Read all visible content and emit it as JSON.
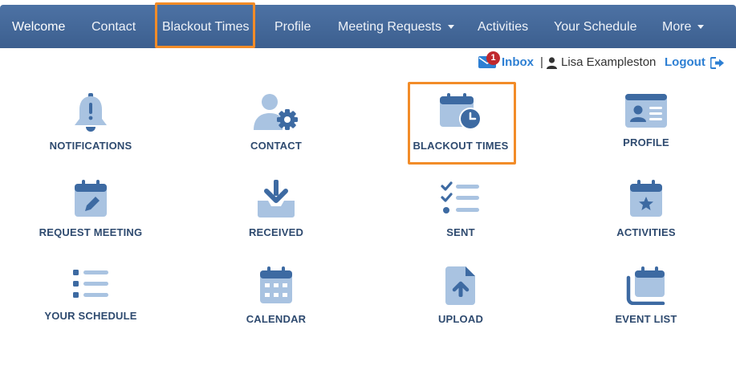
{
  "nav": {
    "items": [
      {
        "label": "Welcome"
      },
      {
        "label": "Contact"
      },
      {
        "label": "Blackout Times"
      },
      {
        "label": "Profile"
      },
      {
        "label": "Meeting Requests"
      },
      {
        "label": "Activities"
      },
      {
        "label": "Your Schedule"
      },
      {
        "label": "More"
      }
    ]
  },
  "userbar": {
    "inbox_label": "Inbox",
    "inbox_count": "1",
    "separator": "|",
    "username": "Lisa Exampleston",
    "logout_label": "Logout"
  },
  "tiles": [
    {
      "label": "NOTIFICATIONS",
      "icon": "bell-icon"
    },
    {
      "label": "CONTACT",
      "icon": "user-gear-icon"
    },
    {
      "label": "BLACKOUT TIMES",
      "icon": "calendar-clock-icon"
    },
    {
      "label": "PROFILE",
      "icon": "id-card-icon"
    },
    {
      "label": "REQUEST MEETING",
      "icon": "calendar-pen-icon"
    },
    {
      "label": "RECEIVED",
      "icon": "inbox-download-icon"
    },
    {
      "label": "SENT",
      "icon": "checklist-icon"
    },
    {
      "label": "ACTIVITIES",
      "icon": "calendar-star-icon"
    },
    {
      "label": "YOUR SCHEDULE",
      "icon": "list-icon"
    },
    {
      "label": "CALENDAR",
      "icon": "calendar-grid-icon"
    },
    {
      "label": "UPLOAD",
      "icon": "file-upload-icon"
    },
    {
      "label": "EVENT LIST",
      "icon": "stacked-calendar-icon"
    }
  ],
  "colors": {
    "navbar": "#4670a0",
    "highlight": "#f28c28",
    "icon_dark": "#3d6aa2",
    "icon_light": "#a9c3e1",
    "label": "#2e4a6f",
    "link": "#2d7fd3",
    "badge": "#c0282d"
  }
}
